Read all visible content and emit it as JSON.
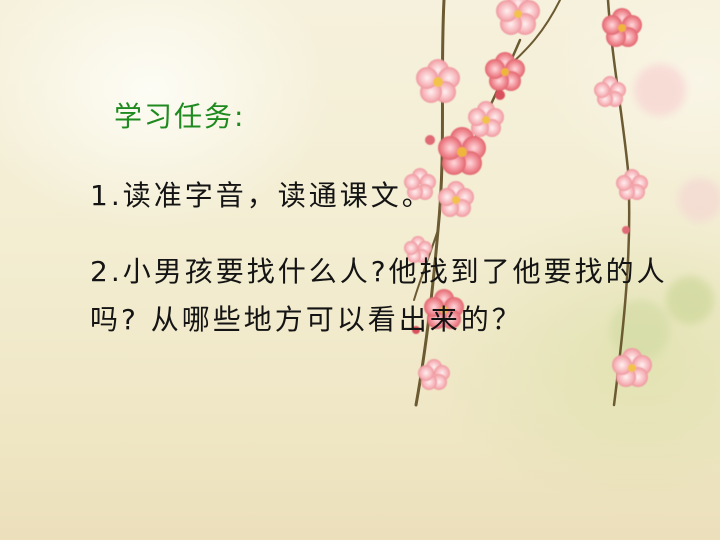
{
  "slide": {
    "title": "学习任务:",
    "items": [
      {
        "text": "1.读准字音，读通课文。"
      },
      {
        "text": "2.小男孩要找什么人?他找到了他要找的人吗? 从哪些地方可以看出来的？"
      }
    ]
  },
  "colors": {
    "title": "#1f8a1f",
    "body_text": "#141414",
    "blossom": "#e86a73",
    "branch": "#6b5a32",
    "background": "#f3edd2"
  },
  "icons": {
    "decoration": "plum-blossom-branch"
  }
}
